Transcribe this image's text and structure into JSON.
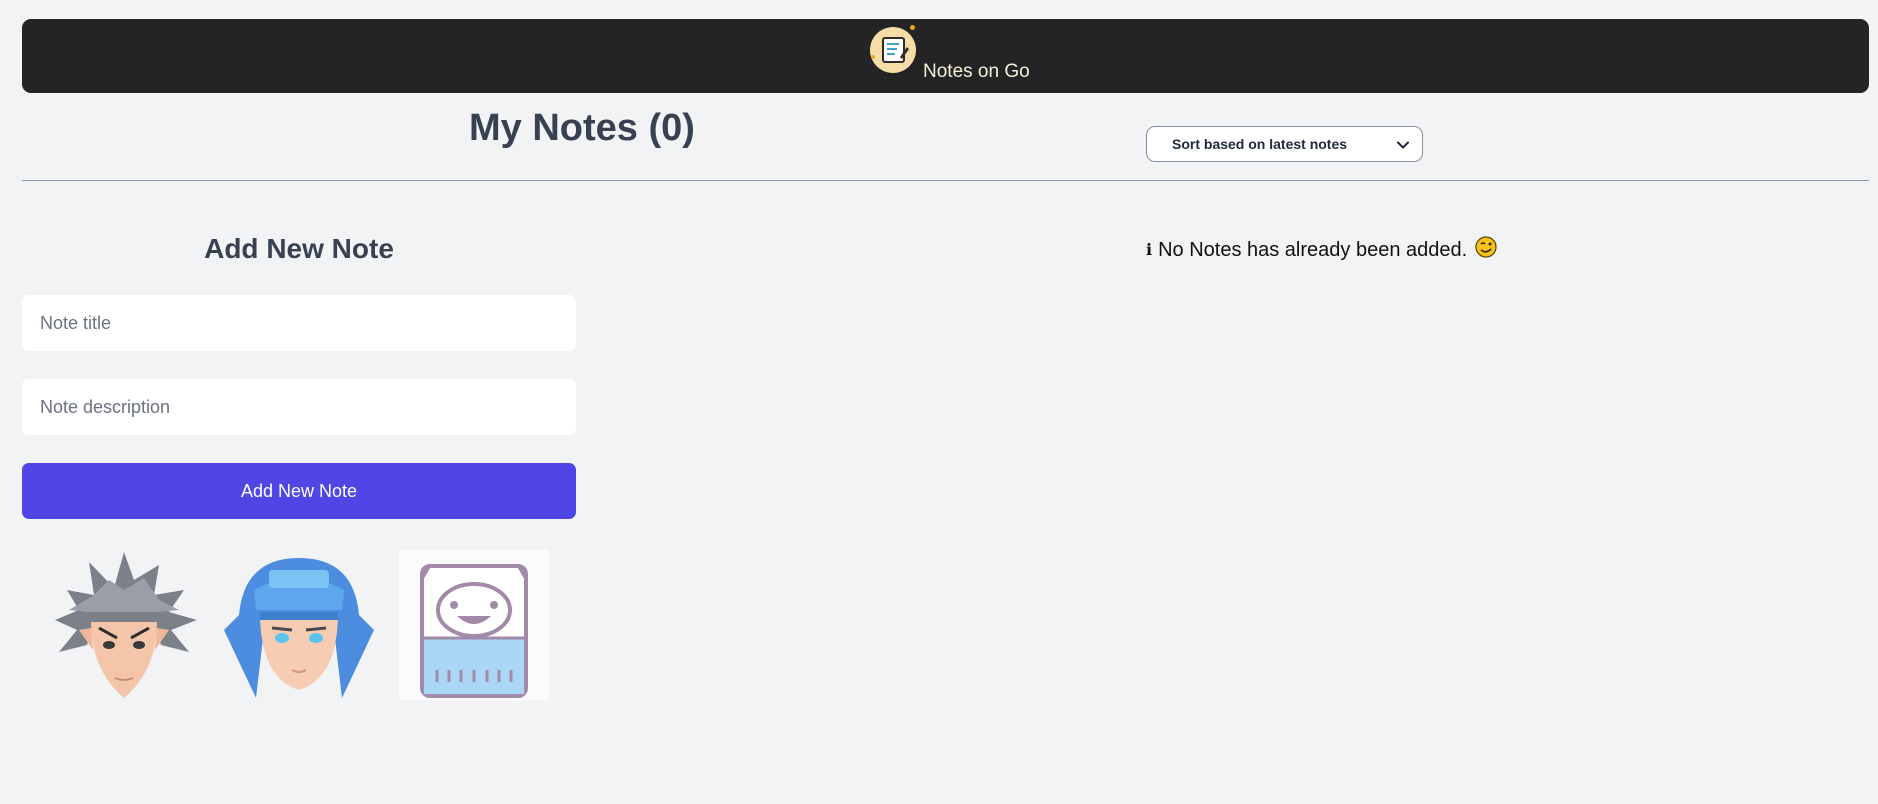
{
  "header": {
    "brand": "Notes on Go",
    "logo_icon": "notepad-logo-icon",
    "background": "#242424"
  },
  "main": {
    "title": "My Notes (0)",
    "sort": {
      "selected": "Sort based on latest notes",
      "icon": "chevron-down-icon"
    },
    "empty_state": {
      "icon": "info-icon",
      "info_glyph": "ℹ",
      "message": "No Notes has already been added.",
      "emoji": "wink-face-icon"
    }
  },
  "form": {
    "heading": "Add New Note",
    "title_placeholder": "Note title",
    "title_value": "",
    "description_placeholder": "Note description",
    "description_value": "",
    "submit_label": "Add New Note",
    "accent": "#4f46e5"
  },
  "avatars": [
    {
      "icon": "spiky-hair-avatar-icon"
    },
    {
      "icon": "blue-hair-avatar-icon"
    },
    {
      "icon": "notepad-character-avatar-icon"
    }
  ]
}
